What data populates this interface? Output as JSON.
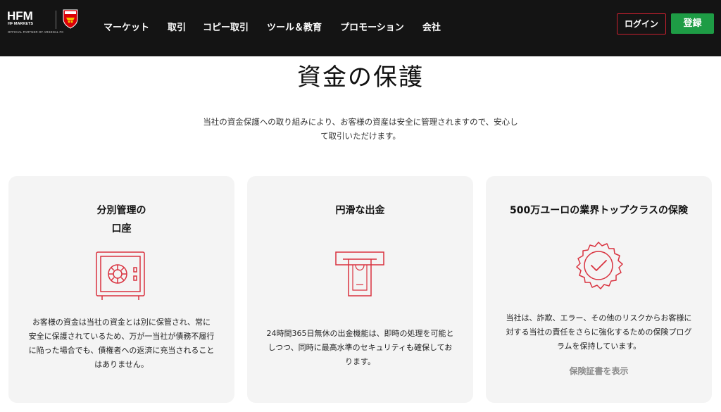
{
  "header": {
    "logo": {
      "brand": "HFM",
      "subtitle": "HF MARKETS",
      "partner": "OFFICIAL PARTNER OF ARSENAL FC"
    },
    "nav": [
      "マーケット",
      "取引",
      "コピー取引",
      "ツール＆教育",
      "プロモーション",
      "会社"
    ],
    "login_label": "ログイン",
    "register_label": "登録"
  },
  "section": {
    "title": "資金の保護",
    "description_line1": "当社の資金保護への取り組みにより、お客様の資産は安全に管理されますので、安心し",
    "description_line2": "て取引いただけます。"
  },
  "cards": [
    {
      "title_line1": "分別管理の",
      "title_line2": "口座",
      "icon": "safe-icon",
      "text_lines": [
        "お客様の資金は当社の資金とは別に保管され、常に",
        "安全に保護されているため、万が一当社が債務不履行",
        "に陥った場合でも、債権者への返済に充当されること",
        "はありません。"
      ]
    },
    {
      "title_line1": "円滑な出金",
      "icon": "atm-withdrawal-icon",
      "text_lines": [
        "24時間365日無休の出金機能は、即時の処理を可能と",
        "しつつ、同時に最高水準のセキュリティも確保してお",
        "ります。"
      ]
    },
    {
      "title_line1": "500万ユーロの業界トップクラスの保険",
      "icon": "certified-badge-icon",
      "text_lines": [
        "当社は、詐欺、エラー、その他のリスクからお客様に",
        "対する当社の責任をさらに強化するための保険プログ",
        "ラムを保持しています。"
      ],
      "link": "保険証書を表示"
    }
  ],
  "colors": {
    "header_bg": "#141414",
    "accent_red": "#c8202f",
    "register_green": "#1e9c45",
    "card_bg": "#f4f4f4"
  }
}
